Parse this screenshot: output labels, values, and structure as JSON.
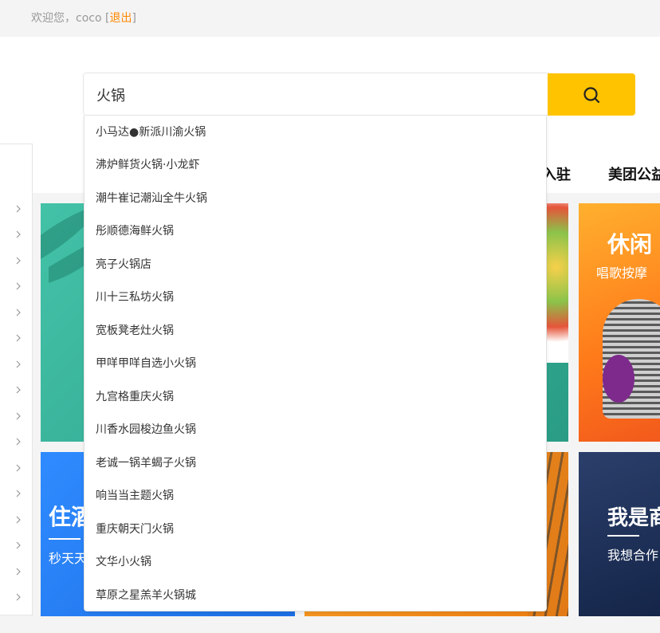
{
  "header": {
    "welcome_text": "欢迎您，coco",
    "logout_open": "[",
    "logout_label": "退出",
    "logout_close": "]"
  },
  "search": {
    "query": "火锅",
    "button_icon": "search-icon"
  },
  "nav": {
    "items": [
      "入驻",
      "美团公益"
    ]
  },
  "suggestions": [
    "小马达●新派川渝火锅",
    "沸炉鲜货火锅·小龙虾",
    "潮牛崔记潮汕全牛火锅",
    "彤顺德海鲜火锅",
    "亮子火锅店",
    "川十三私坊火锅",
    "宽板凳老灶火锅",
    "甲咩甲咩自选小火锅",
    "九宫格重庆火锅",
    "川香水园梭边鱼火锅",
    "老诚一锅羊蝎子火锅",
    "响当当主题火锅",
    "重庆朝天门火锅",
    "文华小火锅",
    "草原之星羔羊火锅城"
  ],
  "cards": {
    "leisure_title": "休闲",
    "leisure_sub": "唱歌按摩",
    "hotel_title": "住酒",
    "hotel_sub": "秒天天",
    "merchant_title": "我是商",
    "merchant_sub": "我想合作"
  },
  "colors": {
    "accent": "#ffc300",
    "link": "#ff8800",
    "teal": "#3bb59e",
    "orange": "#ff8a1a",
    "blue": "#2a7fff",
    "navy": "#1d2b4f"
  }
}
